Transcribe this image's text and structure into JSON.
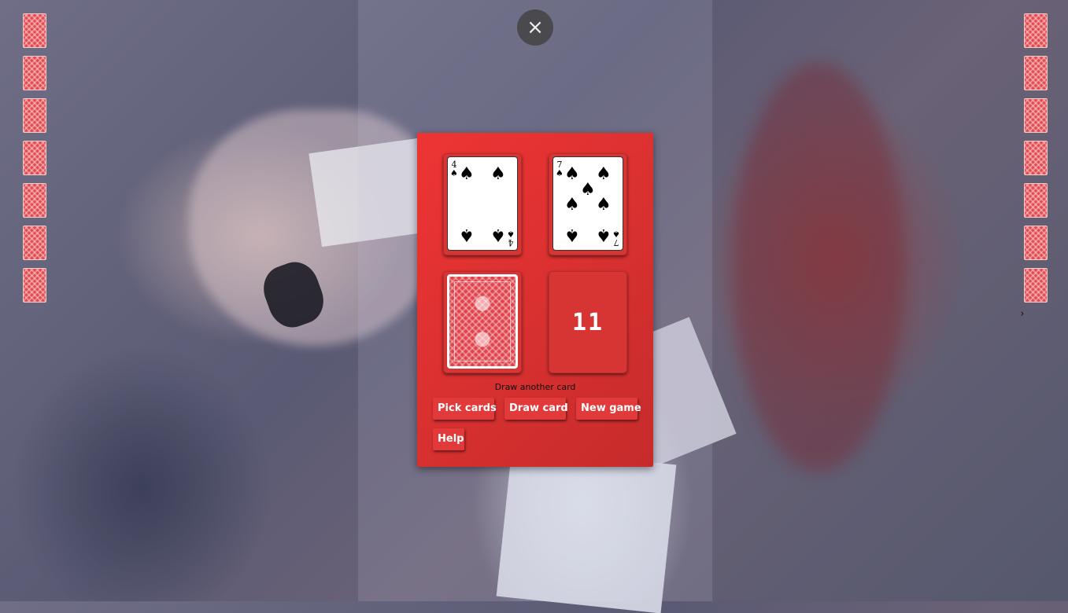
{
  "close": {
    "icon": "close-icon",
    "glyph": "×"
  },
  "nav": {
    "icon": "chevron-right-icon",
    "glyph": "›"
  },
  "cards": {
    "first": {
      "rank": "4",
      "suit": "spade",
      "glyph": "♠"
    },
    "second": {
      "rank": "7",
      "suit": "spade",
      "glyph": "♠"
    },
    "deck": {
      "icon": "card-back-icon"
    }
  },
  "score": "11",
  "status": "Draw another card",
  "buttons": {
    "pick": "Pick cards",
    "draw": "Draw card",
    "new_game": "New game",
    "help": "Help"
  },
  "side_decks": {
    "left_count": 7,
    "right_count": 7
  },
  "colors": {
    "panel": "#e23434",
    "button": "#e23a3a",
    "card_back": "#e0434a"
  }
}
